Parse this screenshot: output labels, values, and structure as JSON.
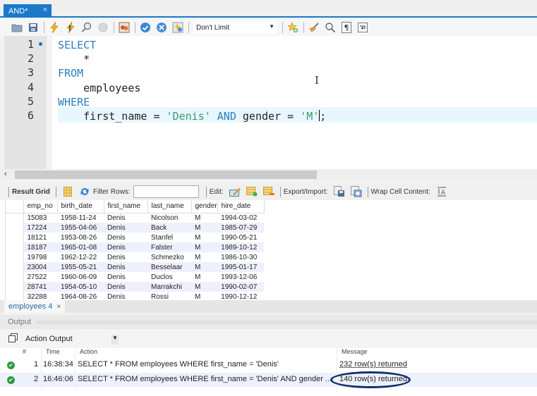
{
  "tab": {
    "title": "AND*",
    "close": "×"
  },
  "toolbar": {
    "icons": [
      "open-folder",
      "save",
      "execute",
      "execute-current",
      "explain",
      "stop",
      "toggle-results",
      "commit",
      "rollback",
      "autocommit"
    ],
    "limit_value": "Don't Limit",
    "icons_right": [
      "add-snippet",
      "beautify",
      "find",
      "invisible-chars",
      "wrap-lines"
    ]
  },
  "editor": {
    "line_numbers": [
      "1",
      "2",
      "3",
      "4",
      "5",
      "6"
    ],
    "lines": [
      {
        "tokens": [
          {
            "type": "kw",
            "text": "SELECT"
          }
        ]
      },
      {
        "tokens": [
          {
            "type": "ident",
            "text": "    *"
          }
        ]
      },
      {
        "tokens": [
          {
            "type": "kw",
            "text": "FROM"
          }
        ]
      },
      {
        "tokens": [
          {
            "type": "ident",
            "text": "    employees"
          }
        ]
      },
      {
        "tokens": [
          {
            "type": "kw",
            "text": "WHERE"
          }
        ]
      },
      {
        "tokens": [
          {
            "type": "ident",
            "text": "    first_name = "
          },
          {
            "type": "str",
            "text": "'Denis'"
          },
          {
            "type": "ident",
            "text": " "
          },
          {
            "type": "kw",
            "text": "AND"
          },
          {
            "type": "ident",
            "text": " gender = "
          },
          {
            "type": "str",
            "text": "'M'"
          },
          {
            "type": "caret",
            "text": ""
          },
          {
            "type": "ident",
            "text": ";"
          }
        ]
      }
    ],
    "ibeam": "I"
  },
  "result_toolbar": {
    "result_grid_label": "Result Grid",
    "filter_label": "Filter Rows:",
    "filter_value": "",
    "edit_label": "Edit:",
    "export_label": "Export/Import:",
    "wrap_label": "Wrap Cell Content:"
  },
  "grid": {
    "columns": [
      "emp_no",
      "birth_date",
      "first_name",
      "last_name",
      "gender",
      "hire_date"
    ],
    "rows": [
      [
        "15083",
        "1958-11-24",
        "Denis",
        "Nicolson",
        "M",
        "1994-03-02"
      ],
      [
        "17224",
        "1955-04-06",
        "Denis",
        "Back",
        "M",
        "1985-07-29"
      ],
      [
        "18121",
        "1953-08-26",
        "Denis",
        "Stanfel",
        "M",
        "1990-05-21"
      ],
      [
        "18187",
        "1965-01-08",
        "Denis",
        "Falster",
        "M",
        "1989-10-12"
      ],
      [
        "19798",
        "1962-12-22",
        "Denis",
        "Schmezko",
        "M",
        "1986-10-30"
      ],
      [
        "23004",
        "1955-05-21",
        "Denis",
        "Besselaar",
        "M",
        "1995-01-17"
      ],
      [
        "27522",
        "1960-06-09",
        "Denis",
        "Duclos",
        "M",
        "1993-12-06"
      ],
      [
        "28741",
        "1954-05-10",
        "Denis",
        "Marrakchi",
        "M",
        "1990-02-07"
      ],
      [
        "32288",
        "1964-08-26",
        "Denis",
        "Rossi",
        "M",
        "1990-12-12"
      ]
    ]
  },
  "result_tab": {
    "label": "employees 4",
    "close": "×"
  },
  "output": {
    "title": "Output",
    "mode": "Action Output",
    "columns": {
      "num": "#",
      "time": "Time",
      "action": "Action",
      "message": "Message"
    },
    "rows": [
      {
        "num": "1",
        "time": "16:38:34",
        "action": "SELECT     * FROM     employees WHERE     first_name = 'Denis'",
        "message": "232 row(s) returned",
        "status": "ok"
      },
      {
        "num": "2",
        "time": "16:46:06",
        "action": "SELECT     * FROM     employees WHERE     first_name = 'Denis' AND gender ...",
        "message": "140 row(s) returned",
        "status": "ok"
      }
    ]
  },
  "colors": {
    "accent": "#1b79c9",
    "keyword": "#2b7fbf",
    "string": "#3a9a6b",
    "success": "#2e9a3e",
    "annotation_ellipse": "#12306b"
  }
}
